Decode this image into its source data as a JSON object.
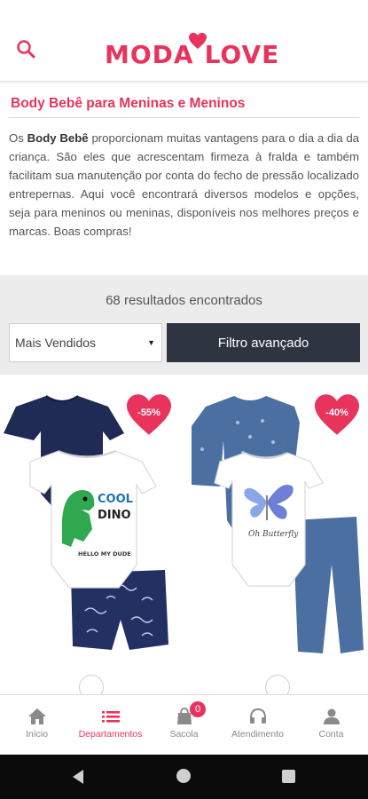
{
  "header": {
    "logo_word1": "MODA",
    "logo_word2": "LOVE"
  },
  "intro": {
    "title": "Body Bebê para Meninas e Meninos",
    "text_prefix": "Os ",
    "text_bold": "Body Bebê",
    "text_body": " proporcionam muitas vantagens para o dia a dia da criança. São eles que acrescentam firmeza à fralda e também facilitam sua manutenção por conta do fecho de pressão localizado entrepernas. Aqui você encontrará diversos modelos e opções, seja para meninos ou meninas, disponíveis nos melhores preços e marcas. Boas compras!"
  },
  "filters": {
    "results_label": "68 resultados encontrados",
    "sort_selected": "Mais Vendidos",
    "advanced_filter_label": "Filtro avançado"
  },
  "products": [
    {
      "discount": "-55%",
      "print_text": "COOL",
      "print_text2": "DINO",
      "print_sub": "HELLO MY DUDE"
    },
    {
      "discount": "-40%",
      "print_text": "Oh Butterfly"
    }
  ],
  "bottom_nav": {
    "items": [
      {
        "label": "Início",
        "icon": "home-icon"
      },
      {
        "label": "Departamentos",
        "icon": "menu-icon"
      },
      {
        "label": "Sacola",
        "icon": "bag-icon"
      },
      {
        "label": "Atendimento",
        "icon": "headset-icon"
      },
      {
        "label": "Conta",
        "icon": "user-icon"
      }
    ],
    "bag_count": "0"
  },
  "colors": {
    "brand": "#e8345c",
    "dark_button": "#2f3540",
    "navy": "#1f2a55",
    "denim": "#4b6fa0"
  }
}
